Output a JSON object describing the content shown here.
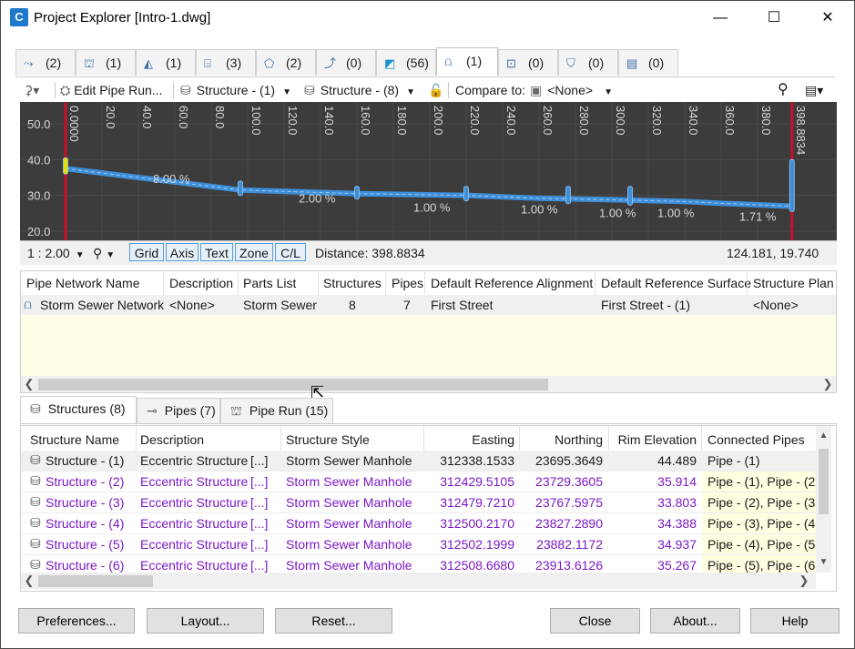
{
  "window": {
    "title": "Project Explorer [Intro-1.dwg]",
    "icon_letter": "C",
    "min_symbol": "—",
    "max_symbol": "☐",
    "close_symbol": "✕"
  },
  "top_tabs": [
    {
      "icon": "alignment-icon",
      "label": "(2)"
    },
    {
      "icon": "profile-icon",
      "label": "(1)"
    },
    {
      "icon": "corridor-icon",
      "label": "(1)"
    },
    {
      "icon": "assembly-icon",
      "label": "(3)"
    },
    {
      "icon": "surface-icon",
      "label": "(2)"
    },
    {
      "icon": "feature-line-icon",
      "label": "(0)"
    },
    {
      "icon": "sample-line-icon",
      "label": "(56)"
    },
    {
      "icon": "pipe-network-icon",
      "label": "(1)"
    },
    {
      "icon": "pressure-network-icon",
      "label": "(0)"
    },
    {
      "icon": "parcel-icon",
      "label": "(0)"
    },
    {
      "icon": "site-icon",
      "label": "(0)"
    }
  ],
  "toolbar": {
    "edit_pipe_run": "Edit Pipe Run...",
    "structure_a": "Structure - (1)",
    "structure_b": "Structure - (8)",
    "compare_to_label": "Compare to:",
    "compare_to_value": "<None>"
  },
  "profile": {
    "y_ticks": [
      "50.0",
      "40.0",
      "30.0",
      "20.0"
    ],
    "x_ticks": [
      "0.0000",
      "20.0",
      "40.0",
      "60.0",
      "80.0",
      "100.0",
      "120.0",
      "140.0",
      "160.0",
      "180.0",
      "200.0",
      "220.0",
      "240.0",
      "260.0",
      "280.0",
      "300.0",
      "320.0",
      "340.0",
      "360.0",
      "380.0",
      "398.8834"
    ],
    "slope_labels": [
      "8.00 %",
      "2.00 %",
      "1.00 %",
      "1.00 %",
      "1.00 %",
      "1.00 %",
      "1.71 %"
    ]
  },
  "status": {
    "scale": "1 : 2.00",
    "grid": "Grid",
    "axis": "Axis",
    "text": "Text",
    "zone": "Zone",
    "cl": "C/L",
    "distance": "Distance: 398.8834",
    "coords": "124.181, 19.740"
  },
  "network_grid": {
    "columns": [
      "Pipe Network Name",
      "Description",
      "Parts List",
      "Structures",
      "Pipes",
      "Default Reference Alignment",
      "Default Reference Surface",
      "Structure Plan l"
    ],
    "row": [
      "Storm Sewer Network",
      "<None>",
      "Storm Sewer",
      "8",
      "7",
      "First Street",
      "First Street - (1)",
      "<None>"
    ]
  },
  "bottom_tabs": [
    {
      "label": "Structures (8)"
    },
    {
      "label": "Pipes (7)"
    },
    {
      "label": "Pipe Run (15)"
    }
  ],
  "structures_grid": {
    "columns": [
      "Structure Name",
      "Description",
      "Structure Style",
      "Easting",
      "Northing",
      "Rim Elevation",
      "Connected Pipes"
    ],
    "rows": [
      [
        "Structure - (1)",
        "Eccentric Structure",
        "[...]",
        "Storm Sewer Manhole",
        "312338.1533",
        "23695.3649",
        "44.489",
        "Pipe - (1)"
      ],
      [
        "Structure - (2)",
        "Eccentric Structure",
        "[...]",
        "Storm Sewer Manhole",
        "312429.5105",
        "23729.3605",
        "35.914",
        "Pipe - (1), Pipe - (2"
      ],
      [
        "Structure - (3)",
        "Eccentric Structure",
        "[...]",
        "Storm Sewer Manhole",
        "312479.7210",
        "23767.5975",
        "33.803",
        "Pipe - (2), Pipe - (3"
      ],
      [
        "Structure - (4)",
        "Eccentric Structure",
        "[...]",
        "Storm Sewer Manhole",
        "312500.2170",
        "23827.2890",
        "34.388",
        "Pipe - (3), Pipe - (4"
      ],
      [
        "Structure - (5)",
        "Eccentric Structure",
        "[...]",
        "Storm Sewer Manhole",
        "312502.1999",
        "23882.1172",
        "34.937",
        "Pipe - (4), Pipe - (5"
      ],
      [
        "Structure - (6)",
        "Eccentric Structure",
        "[...]",
        "Storm Sewer Manhole",
        "312508.6680",
        "23913.6126",
        "35.267",
        "Pipe - (5), Pipe - (6"
      ]
    ]
  },
  "buttons": {
    "preferences": "Preferences...",
    "layout": "Layout...",
    "reset": "Reset...",
    "close": "Close",
    "about": "About...",
    "help": "Help"
  }
}
